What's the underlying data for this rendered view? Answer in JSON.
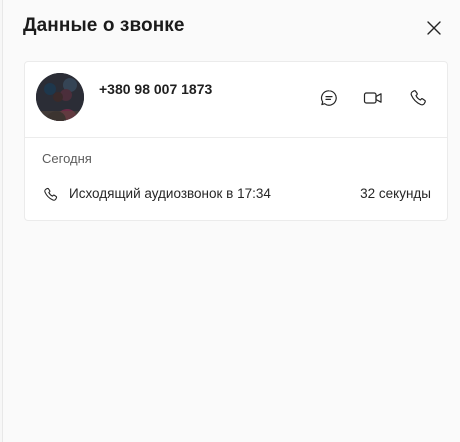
{
  "panel": {
    "title": "Данные о звонке"
  },
  "contact": {
    "phone": "+380 98 007 1873"
  },
  "history": {
    "day": "Сегодня",
    "calls": [
      {
        "description": "Исходящий аудиозвонок в 17:34",
        "duration": "32 секунды"
      }
    ]
  },
  "icons": {
    "close": "close-icon",
    "chat": "chat-icon",
    "video": "video-camera-icon",
    "call": "phone-icon"
  },
  "colors": {
    "icon": "#242424",
    "background": "#fafafa",
    "card": "#ffffff"
  }
}
